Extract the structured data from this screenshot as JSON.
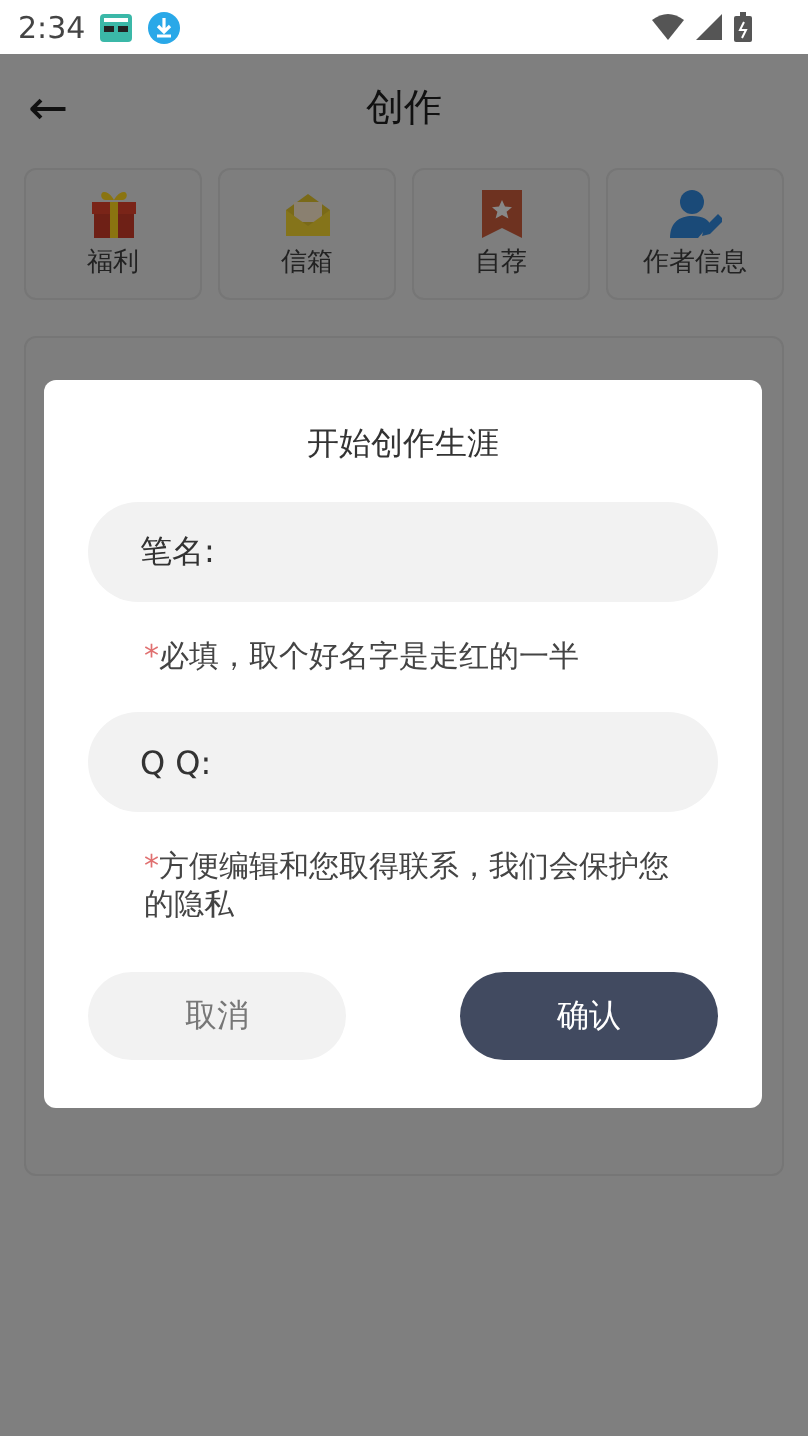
{
  "status_bar": {
    "time": "2:34"
  },
  "header": {
    "back": "←",
    "title": "创作"
  },
  "shortcuts": [
    {
      "label": "福利",
      "kind": "gift"
    },
    {
      "label": "信箱",
      "kind": "mail"
    },
    {
      "label": "自荐",
      "kind": "bookmark"
    },
    {
      "label": "作者信息",
      "kind": "author"
    }
  ],
  "dialog": {
    "title": "开始创作生涯",
    "fields": [
      {
        "label": "笔名:",
        "mark": "*",
        "hint": "必填，取个好名字是走红的一半"
      },
      {
        "label": "Q Q:",
        "mark": "*",
        "hint": "方便编辑和您取得联系，我们会保护您的隐私"
      }
    ],
    "buttons": [
      {
        "label": "取消",
        "kind": "secondary"
      },
      {
        "label": "确认",
        "kind": "primary"
      }
    ]
  }
}
